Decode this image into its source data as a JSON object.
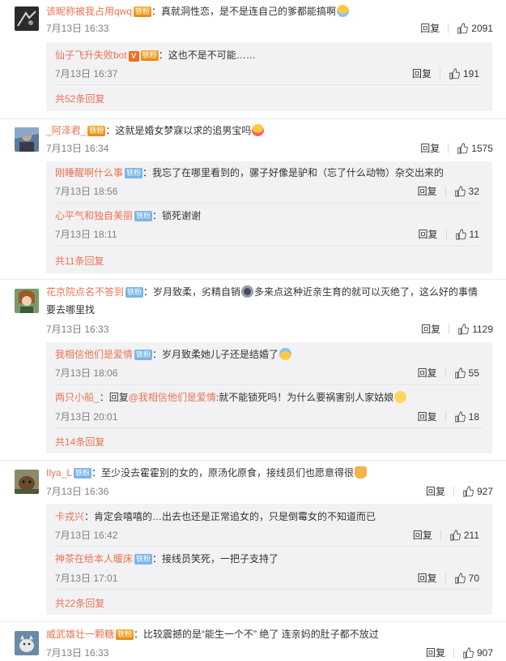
{
  "colors": {
    "username": "#eb7350",
    "meta": "#808080",
    "sub_bg": "#f2f2f5"
  },
  "comments": [
    {
      "user": "该昵称被我占用qwq",
      "badge": "铁粉",
      "badge_style": "gold",
      "text": "：真就洞性恋，是不是连自己的爹都能搞啊",
      "emoji": "crying-emoji",
      "date": "7月13日 16:33",
      "reply": "回复",
      "likes": "2091",
      "replies": [
        {
          "user": "仙子飞升失败bot",
          "vip": "V",
          "badge": "铁粉",
          "badge_style": "gold",
          "text": "：这也不是不可能……",
          "date": "7月13日 16:37",
          "reply": "回复",
          "likes": "191"
        }
      ],
      "more": "共52条回复"
    },
    {
      "user": "_阿泽君_",
      "badge": "铁粉",
      "badge_style": "gold",
      "text": "：这就是婚女梦寐以求的追男宝吗",
      "emoji": "tongue-emoji",
      "date": "7月13日 16:34",
      "reply": "回复",
      "likes": "1575",
      "replies": [
        {
          "user": "刚睡醒啊什么事",
          "badge": "铁粉",
          "badge_style": "iron",
          "text": "：我忘了在哪里看到的，骡子好像是驴和（忘了什么动物）杂交出来的",
          "date": "7月13日 18:56",
          "reply": "回复",
          "likes": "32"
        },
        {
          "user": "心平气和独自美丽",
          "badge": "铁粉",
          "badge_style": "iron",
          "text": "：锁死谢谢",
          "date": "7月13日 18:11",
          "reply": "回复",
          "likes": "11"
        }
      ],
      "more": "共11条回复"
    },
    {
      "user": "花京院点名不答到",
      "badge": "铁粉",
      "badge_style": "iron",
      "text": "：岁月致柔，劣精自销",
      "text2": "多来点这种近亲生育的就可以灭绝了，这么好的事情",
      "line2": "要去哪里找",
      "date": "7月13日 16:33",
      "reply": "回复",
      "likes": "1129",
      "replies": [
        {
          "user": "我相信他们是爱情",
          "badge": "铁粉",
          "badge_style": "iron",
          "text": "：岁月致柔她儿子还是结婚了",
          "date": "7月13日 18:06",
          "reply": "回复",
          "likes": "55"
        },
        {
          "user": "两只小船_",
          "badge": "",
          "prefix": "：回复",
          "mention": "@我相信他们是爱情",
          "text": ":就不能锁死吗！为什么要祸害别人家姑娘",
          "date": "7月13日 20:01",
          "reply": "回复",
          "likes": "18"
        }
      ],
      "more": "共14条回复"
    },
    {
      "user": "Ilya_L",
      "badge": "铁粉",
      "badge_style": "iron",
      "text": "：至少没去霍霍别的女的，原汤化原食，接线员们也愿意得很",
      "date": "7月13日 16:36",
      "reply": "回复",
      "likes": "927",
      "replies": [
        {
          "user": "卡戎兴",
          "badge": "",
          "text": "：肯定会嘻嘻的…出去也还是正常追女的，只是倒霉女的不知道而已",
          "date": "7月13日 16:42",
          "reply": "回复",
          "likes": "211"
        },
        {
          "user": "神茶在给本人暖床",
          "badge": "铁粉",
          "badge_style": "iron",
          "text": "：接线员笑死，一把子支持了",
          "date": "7月13日 17:01",
          "reply": "回复",
          "likes": "70"
        }
      ],
      "more": "共22条回复"
    },
    {
      "user": "威武雄壮一颗糖",
      "badge": "铁粉",
      "badge_style": "gold",
      "text": "：比较震撼的是“能生一个不” 绝了 连亲妈的肚子都不放过",
      "date": "7月13日 16:33",
      "reply": "回复",
      "likes": "907"
    }
  ]
}
